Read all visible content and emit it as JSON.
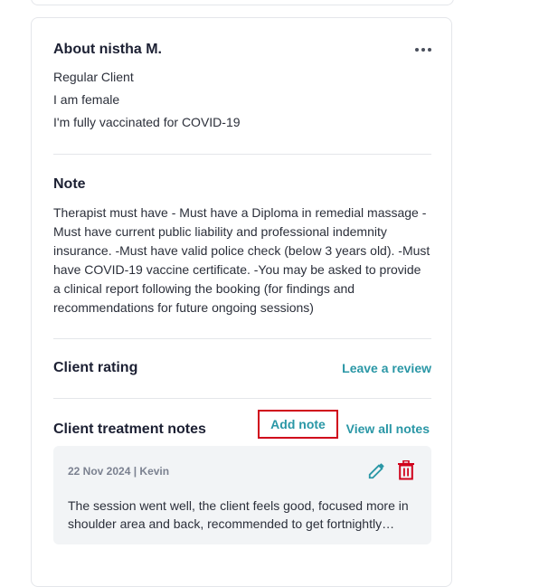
{
  "about": {
    "title": "About nistha M.",
    "lines": [
      "Regular Client",
      "I am female",
      "I'm fully vaccinated for COVID-19"
    ]
  },
  "note": {
    "title": "Note",
    "text": "Therapist must have - Must have a Diploma in remedial massage -Must have current public liability and professional indemnity insurance. -Must have valid police check (below 3 years old). -Must have COVID-19 vaccine certificate. -You may be asked to provide a clinical report following the booking (for findings and recommendations for future ongoing sessions)"
  },
  "rating": {
    "title": "Client rating",
    "leave_review": "Leave a review"
  },
  "treatment": {
    "title": "Client treatment notes",
    "add_note": "Add note",
    "view_all": "View all notes",
    "entry": {
      "meta": "22 Nov 2024 | Kevin",
      "body": "The session went well, the client feels good, focused more in shoulder area and back, recommended to get fortnightly sessions"
    }
  },
  "colors": {
    "accent": "#2a97a6",
    "delete": "#d0021b",
    "highlight_box": "#d0021b"
  },
  "icons": [
    "more-icon",
    "edit-icon",
    "trash-icon"
  ]
}
